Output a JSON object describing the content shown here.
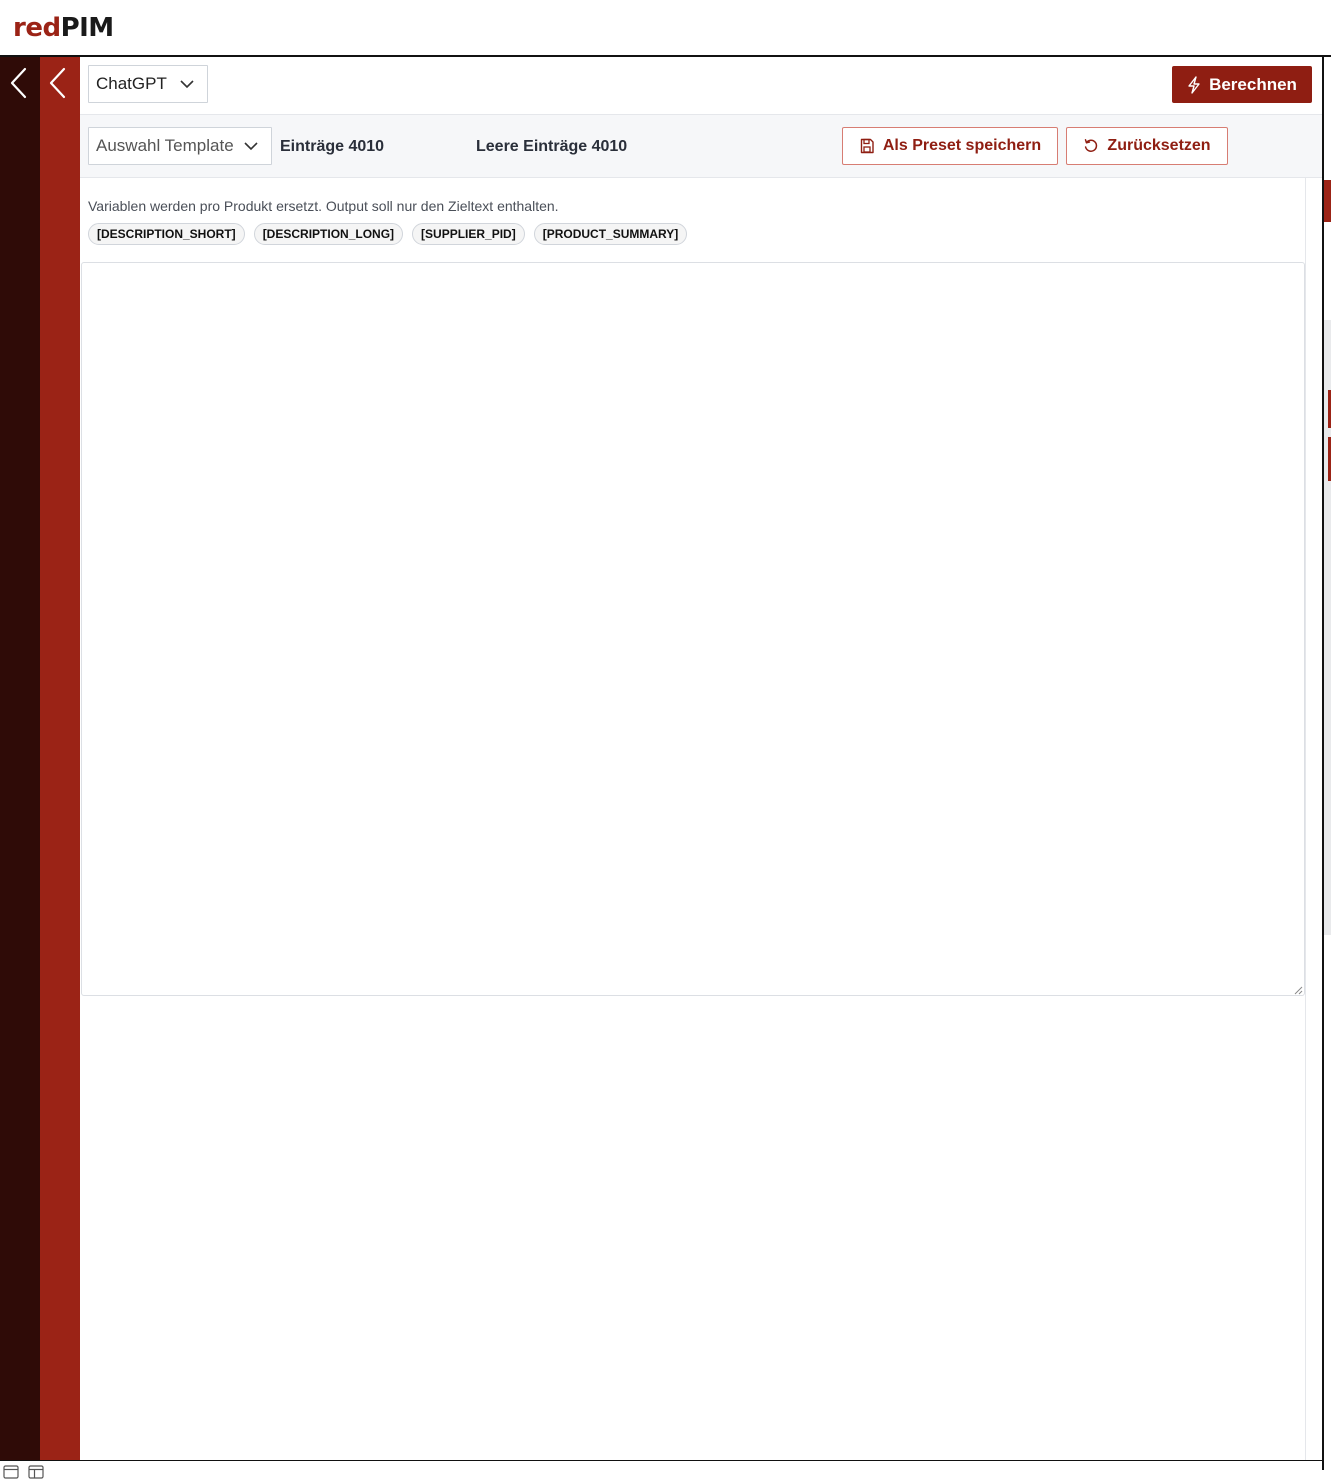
{
  "app": {
    "logo_red": "red",
    "logo_dark": "PIM"
  },
  "colors": {
    "brand_red": "#9b2316",
    "rail_dark": "#2f0b07",
    "button_primary": "#8f1e12"
  },
  "rails": {
    "collapse_outer_icon": "chevron-left-icon",
    "collapse_inner_icon": "chevron-left-icon"
  },
  "toolbar": {
    "model_select_value": "ChatGPT",
    "calculate_label": "Berechnen",
    "calculate_icon": "lightning-icon"
  },
  "subtoolbar": {
    "template_select_value": "Auswahl Template",
    "entries_label": "Einträge 4010",
    "empty_entries_label": "Leere Einträge 4010",
    "save_preset_label": "Als Preset speichern",
    "save_preset_icon": "floppy-disk-icon",
    "reset_label": "Zurücksetzen",
    "reset_icon": "undo-icon"
  },
  "editor": {
    "hint": "Variablen werden pro Produkt ersetzt. Output soll nur den Zieltext enthalten.",
    "variables": [
      "[DESCRIPTION_SHORT]",
      "[DESCRIPTION_LONG]",
      "[SUPPLIER_PID]",
      "[PRODUCT_SUMMARY]"
    ],
    "prompt_value": ""
  },
  "footer": {
    "icons": [
      "window-icon",
      "layout-split-icon"
    ]
  }
}
